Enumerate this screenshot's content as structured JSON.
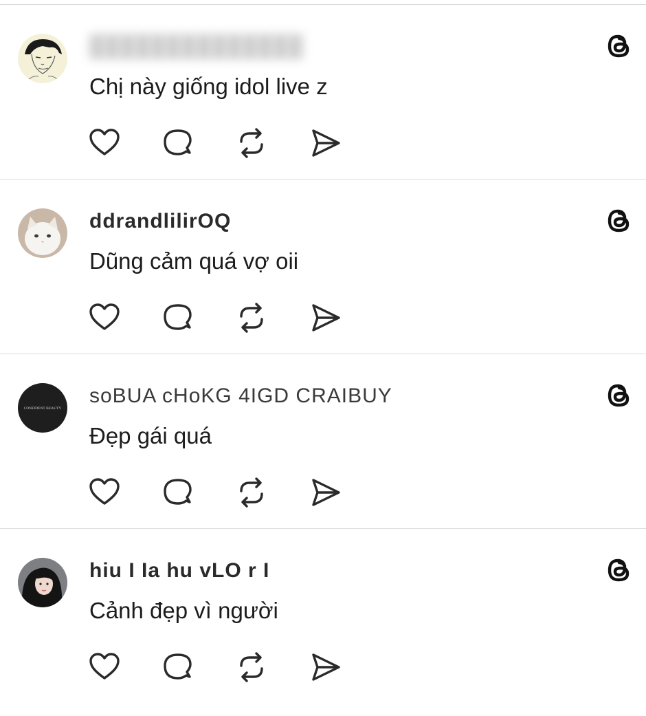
{
  "posts": [
    {
      "username": "",
      "username_faded": "",
      "comment": "Chị này giống idol live z",
      "avatar": "avatar-sketch-man"
    },
    {
      "username": "ddrandlilirOQ",
      "username_faded": "",
      "comment": "Dũng cảm quá vợ oii",
      "avatar": "avatar-white-cat"
    },
    {
      "username": "soBUA cHoKG 4IGD CRAIBUY",
      "username_faded": "",
      "comment": "Đẹp gái quá",
      "avatar": "avatar-confident-beauty"
    },
    {
      "username": "hiu I Ia hu vLO r I",
      "username_faded": "",
      "comment": "Cảnh đẹp vì người",
      "avatar": "avatar-girl-photo"
    }
  ],
  "icons": {
    "brand": "threads-logo-icon",
    "like": "heart-icon",
    "reply": "comment-bubble-icon",
    "repost": "repost-icon",
    "share": "send-icon"
  },
  "colors": {
    "text": "#1c1c1c",
    "divider": "#dcdcdc",
    "icon": "#2a2a2a"
  },
  "avatar_text": {
    "post_3": "CONFIDENT BEAUTY"
  }
}
